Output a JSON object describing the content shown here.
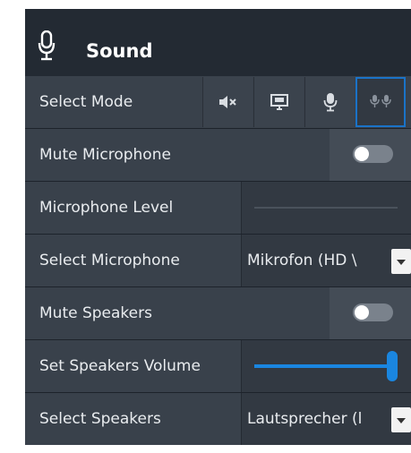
{
  "header": {
    "title": "Sound",
    "icon": "microphone-icon"
  },
  "rows": {
    "select_mode": {
      "label": "Select Mode",
      "modes": [
        {
          "name": "mute",
          "icon": "speaker-mute-icon"
        },
        {
          "name": "screen",
          "icon": "screen-share-icon"
        },
        {
          "name": "microphone",
          "icon": "microphone-icon"
        },
        {
          "name": "dual-microphone",
          "icon": "dual-microphone-icon",
          "active": true
        }
      ]
    },
    "mute_microphone": {
      "label": "Mute Microphone",
      "toggle_on": false
    },
    "microphone_level": {
      "label": "Microphone Level",
      "level": 0
    },
    "select_microphone": {
      "label": "Select Microphone",
      "value": "Mikrofon (HD \\"
    },
    "mute_speakers": {
      "label": "Mute Speakers",
      "toggle_on": false
    },
    "speakers_volume": {
      "label": "Set Speakers Volume",
      "level": 1.0
    },
    "select_speakers": {
      "label": "Select Speakers",
      "value": "Lautsprecher (l"
    }
  },
  "colors": {
    "accent": "#1a86e0",
    "panel": "#232a33",
    "row_label_bg": "#39414b",
    "text": "#e9ecef"
  }
}
